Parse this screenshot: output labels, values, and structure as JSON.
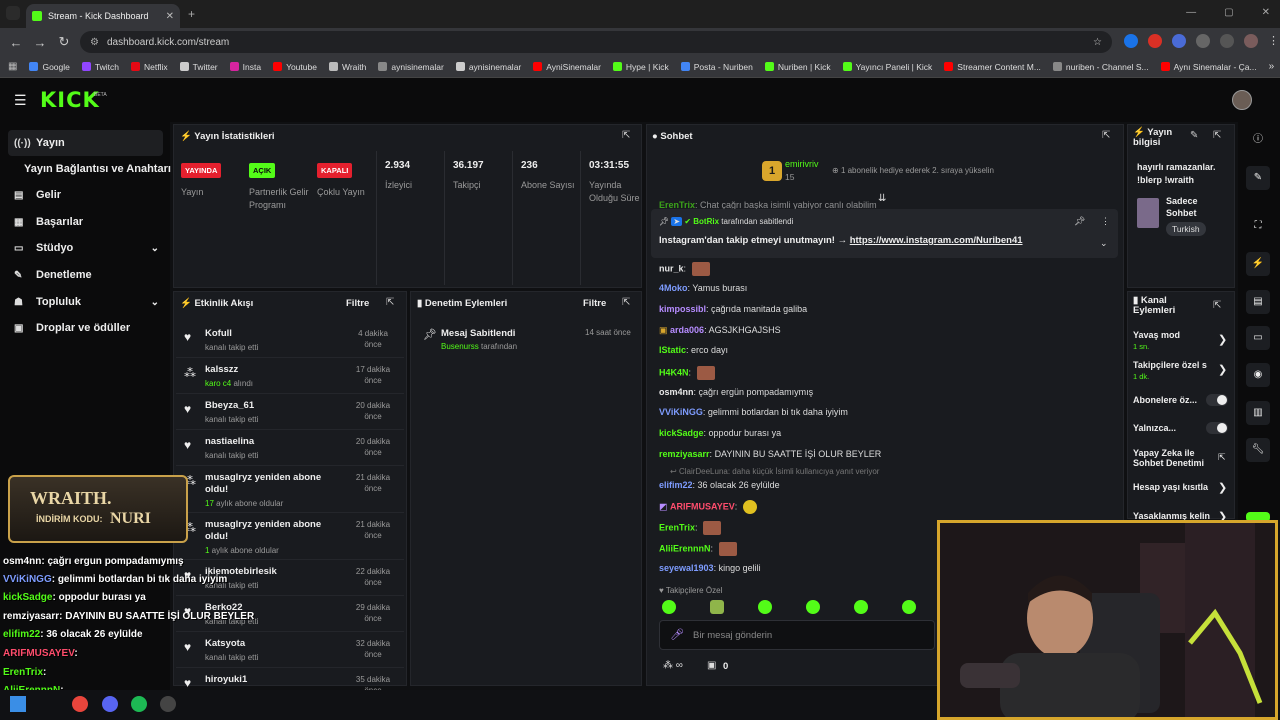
{
  "browser": {
    "tab_title": "Stream - Kick Dashboard",
    "url": "dashboard.kick.com/stream",
    "new_tab": "+"
  },
  "bookmarks": [
    {
      "label": "Google",
      "color": "#4285f4"
    },
    {
      "label": "Twitch",
      "color": "#9146ff"
    },
    {
      "label": "Netflix",
      "color": "#e50914"
    },
    {
      "label": "Twitter",
      "color": "#cccccc"
    },
    {
      "label": "Insta",
      "color": "#d6249f"
    },
    {
      "label": "Youtube",
      "color": "#ff0000"
    },
    {
      "label": "Wraith",
      "color": "#bbbbbb"
    },
    {
      "label": "aynisinemalar",
      "color": "#888888"
    },
    {
      "label": "aynisinemalar",
      "color": "#cccccc"
    },
    {
      "label": "AyniSinemalar",
      "color": "#ff0000"
    },
    {
      "label": "Hype | Kick",
      "color": "#53fc18"
    },
    {
      "label": "Posta - Nuriben",
      "color": "#4285f4"
    },
    {
      "label": "Nuriben | Kick",
      "color": "#53fc18"
    },
    {
      "label": "Yayıncı Paneli | Kick",
      "color": "#53fc18"
    },
    {
      "label": "Streamer Content M...",
      "color": "#ff0000"
    },
    {
      "label": "nuriben - Channel S...",
      "color": "#888888"
    },
    {
      "label": "Aynı Sinemalar - Ça...",
      "color": "#ff0000"
    }
  ],
  "header": {
    "logo": "KICK",
    "beta": "BETA"
  },
  "sidebar": {
    "items": [
      {
        "label": "Yayın",
        "icon": "broadcast-icon"
      },
      {
        "label": "Yayın Bağlantısı ve Anahtarı"
      },
      {
        "label": "Gelir",
        "icon": "revenue-icon"
      },
      {
        "label": "Başarılar",
        "icon": "achievements-icon"
      },
      {
        "label": "Stüdyo",
        "icon": "studio-icon"
      },
      {
        "label": "Denetleme",
        "icon": "moderation-icon"
      },
      {
        "label": "Topluluk",
        "icon": "community-icon"
      },
      {
        "label": "Droplar ve ödüller",
        "icon": "drops-icon"
      }
    ]
  },
  "stats": {
    "title": "Yayın İstatistikleri",
    "badges": [
      {
        "badge": "YAYINDA",
        "label": "Yayın"
      },
      {
        "badge": "AÇIK",
        "label": "Partnerlik Gelir Programı"
      },
      {
        "badge": "KAPALI",
        "label": "Çoklu Yayın"
      }
    ],
    "numbers": [
      {
        "value": "2.934",
        "label": "İzleyici"
      },
      {
        "value": "36.197",
        "label": "Takipçi"
      },
      {
        "value": "236",
        "label": "Abone Sayısı"
      },
      {
        "value": "03:31:55",
        "label": "Yayında Olduğu Süre"
      }
    ]
  },
  "activity": {
    "title": "Etkinlik Akışı",
    "filter": "Filtre",
    "rows": [
      {
        "name": "Kofull",
        "sub": "kanalı takip etti",
        "time": "4 dakika önce"
      },
      {
        "name": "kalsszz",
        "sub_green": "karo c4",
        "sub": " alındı",
        "time": "17 dakika önce"
      },
      {
        "name": "Bbeyza_61",
        "sub": "kanalı takip etti",
        "time": "20 dakika önce"
      },
      {
        "name": "nastiaelina",
        "sub": "kanalı takip etti",
        "time": "20 dakika önce"
      },
      {
        "name": "musaglryz yeniden abone oldu!",
        "sub_green": "17",
        "sub": " aylık abone oldular",
        "time": "21 dakika önce"
      },
      {
        "name": "musaglryz yeniden abone oldu!",
        "sub_green": "1",
        "sub": " aylık abone oldular",
        "time": "21 dakika önce"
      },
      {
        "name": "ikiemotebirlesik",
        "sub": "kanalı takip etti",
        "time": "22 dakika önce"
      },
      {
        "name": "Berko22",
        "sub": "kanalı takip etti",
        "time": "29 dakika önce"
      },
      {
        "name": "Katsyota",
        "sub": "kanalı takip etti",
        "time": "32 dakika önce"
      },
      {
        "name": "hiroyuki1",
        "sub": "",
        "time": "35 dakika önce"
      }
    ]
  },
  "moderation": {
    "title": "Denetim Eylemleri",
    "filter": "Filtre",
    "item": {
      "title": "Mesaj Sabitlendi",
      "by": "Busenurss",
      "by_suffix": " tarafından",
      "time": "14 saat önce"
    }
  },
  "chat": {
    "title": "Sohbet",
    "top": {
      "user": "emirivriv",
      "count": "15",
      "gift_text": "1 abonelik hediye ederek 2. sıraya yükselin"
    },
    "cut_line": {
      "user": "ErenTrix",
      "text": ": Chat çağrı başka isimli yabiyor canlı olabilim"
    },
    "pinned": {
      "by": "BotRix",
      "by_suffix": "tarafından sabitlendi",
      "text": "Instagram'dan takip etmeyi unutmayın! → ",
      "link": "https://www.instagram.com/Nuriben41"
    },
    "messages": [
      {
        "user": "nur_k",
        "color": "#e8e8e8",
        "text": "",
        "emote": true
      },
      {
        "user": "4Moko",
        "color": "#7e9cff",
        "text": "Yamus burası"
      },
      {
        "user": "kimpossibl",
        "color": "#b68cff",
        "text": "çağrıda manitada galiba"
      },
      {
        "user": "arda006",
        "color": "#b68cff",
        "text": "AGSJKHGAJSHS"
      },
      {
        "user": "lStatic",
        "color": "#53fc18",
        "text": "erco dayı"
      },
      {
        "user": "H4K4N",
        "color": "#53fc18",
        "text": "",
        "emote": true
      },
      {
        "user": "osm4nn",
        "color": "#e8e8e8",
        "text": "çağrı ergün pompadamıymış"
      },
      {
        "user": "VViKiNGG",
        "color": "#7e9cff",
        "text": "gelimmi botlardan bi tık daha iyiyim"
      },
      {
        "user": "kickSadge",
        "color": "#53fc18",
        "text": "oppodur burası ya"
      },
      {
        "user": "remziyasarr",
        "color": "#53fc18",
        "text": "DAYININ BU SAATTE İŞİ OLUR BEYLER"
      },
      {
        "user": "elifim22",
        "color": "#7e9cff",
        "text": "36 olacak 26 eylülde"
      },
      {
        "user": "ARIFMUSAYEV",
        "color": "#ff4d6d",
        "text": "",
        "emote": true
      },
      {
        "user": "ErenTrix",
        "color": "#53fc18",
        "text": "",
        "emote": true
      },
      {
        "user": "AliiErennnN",
        "color": "#53fc18",
        "text": "",
        "emote": true
      },
      {
        "user": "seyewal1903",
        "color": "#7e9cff",
        "text": "kingo gelili"
      }
    ],
    "reply_note": "ClairDeeLuna: daha küçük İsimli kullanıcıya yanıt veriyor",
    "followers_only": "Takipçilere Özel",
    "input_placeholder": "Bir mesaj gönderin",
    "footer_count": "0"
  },
  "stream_info": {
    "title": "Yayın bilgisi",
    "text": "hayırlı ramazanlar. !blerp !wraith",
    "category": "Sadece Sohbet",
    "tag": "Turkish"
  },
  "channel_actions": {
    "title": "Kanal Eylemleri",
    "items": [
      {
        "label": "Yavaş mod",
        "sub": "1 sn.",
        "type": "arrow"
      },
      {
        "label": "Takipçilere özel s",
        "sub": "1 dk.",
        "type": "arrow"
      },
      {
        "label": "Abonelere öz...",
        "type": "toggle"
      },
      {
        "label": "Yalnızca...",
        "type": "toggle"
      },
      {
        "label": "Yapay Zeka ile Sohbet Denetimi",
        "type": "link"
      },
      {
        "label": "Hesap yaşı kısıtla",
        "type": "arrow"
      },
      {
        "label": "Yasaklanmış kelin",
        "type": "arrow"
      }
    ]
  },
  "overlay": {
    "brand": "WRAITH.",
    "code_label": "İNDİRİM KODU:",
    "code": "NURI",
    "lines": [
      {
        "user": "osm4nn",
        "text": ": çağrı ergun pompadamıymış",
        "color": "#ffffff"
      },
      {
        "user": "VViKiNGG",
        "text": ": gelimmi botlardan bi tık daha iyiyim",
        "color": "#7e9cff"
      },
      {
        "user": "kickSadge",
        "text": ": oppodur burası ya",
        "color": "#53fc18"
      },
      {
        "user": "remziyasarr",
        "text": ": DAYININ BU SAATTE İŞİ OLUR BEYLER",
        "color": "#ffffff"
      },
      {
        "user": "elifim22",
        "text": ": 36 olacak 26 eylülde",
        "color": "#53fc18"
      },
      {
        "user": "ARIFMUSAYEV",
        "text": ":",
        "color": "#ff4d6d"
      },
      {
        "user": "ErenTrix",
        "text": ":",
        "color": "#53fc18"
      },
      {
        "user": "AliiErennnN",
        "text": ":",
        "color": "#53fc18"
      },
      {
        "user": "",
        "text": "ingo gelili",
        "color": "#ffffff"
      }
    ]
  },
  "colors": {
    "kick_green": "#53fc18",
    "live_red": "#e5202e",
    "panel": "#191b1f",
    "webcam_border": "#d6a62c"
  }
}
